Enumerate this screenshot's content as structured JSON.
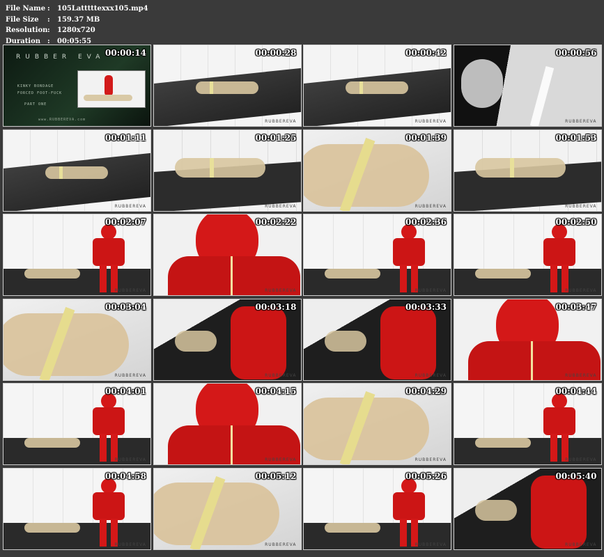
{
  "header": {
    "rows": [
      {
        "key": "File Name",
        "value": "105Latttttexxx105.mp4"
      },
      {
        "key": "File Size",
        "value": "159.37 MB"
      },
      {
        "key": "Resolution",
        "value": "1280x720"
      },
      {
        "key": "Duration",
        "value": "00:05:55"
      }
    ],
    "separator": ":"
  },
  "title_card": {
    "brand": "RUBBER EVA",
    "line1": "KINKY BONDAGE",
    "line2": "FORCED FOOT-FUCK",
    "line3": "PART ONE",
    "url": "www.RUBBEREVA.com"
  },
  "watermark": "RUBBEREVA",
  "thumbnails": [
    {
      "time": "00:00:14",
      "scene": "title"
    },
    {
      "time": "00:00:28",
      "scene": "tile-wide"
    },
    {
      "time": "00:00:42",
      "scene": "tile-wide"
    },
    {
      "time": "00:00:56",
      "scene": "bw-close"
    },
    {
      "time": "00:01:11",
      "scene": "tile-wide"
    },
    {
      "time": "00:01:25",
      "scene": "tile-mid"
    },
    {
      "time": "00:01:39",
      "scene": "body-close"
    },
    {
      "time": "00:01:53",
      "scene": "tile-mid"
    },
    {
      "time": "00:02:07",
      "scene": "red-figure"
    },
    {
      "time": "00:02:22",
      "scene": "red-close"
    },
    {
      "time": "00:02:36",
      "scene": "red-figure"
    },
    {
      "time": "00:02:50",
      "scene": "red-figure"
    },
    {
      "time": "00:03:04",
      "scene": "body-close"
    },
    {
      "time": "00:03:18",
      "scene": "red-dark"
    },
    {
      "time": "00:03:33",
      "scene": "red-dark"
    },
    {
      "time": "00:03:47",
      "scene": "red-close"
    },
    {
      "time": "00:04:01",
      "scene": "red-figure"
    },
    {
      "time": "00:04:15",
      "scene": "red-close"
    },
    {
      "time": "00:04:29",
      "scene": "body-close"
    },
    {
      "time": "00:04:44",
      "scene": "red-figure"
    },
    {
      "time": "00:04:58",
      "scene": "red-figure"
    },
    {
      "time": "00:05:12",
      "scene": "body-close"
    },
    {
      "time": "00:05:26",
      "scene": "red-figure"
    },
    {
      "time": "00:05:40",
      "scene": "red-dark"
    }
  ]
}
